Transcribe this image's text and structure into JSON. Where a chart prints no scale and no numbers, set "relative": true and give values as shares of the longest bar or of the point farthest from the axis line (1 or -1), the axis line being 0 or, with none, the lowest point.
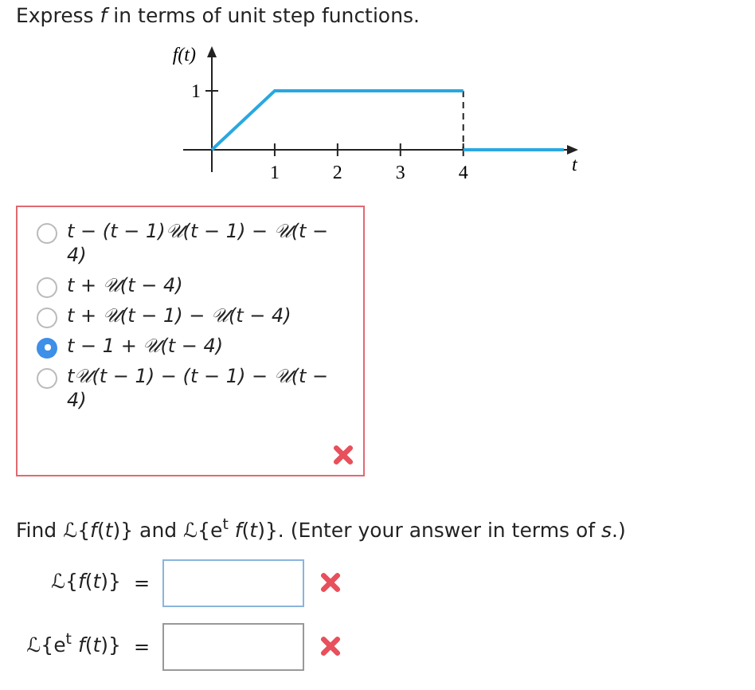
{
  "prompt": "Express *f* in terms of unit step functions.",
  "graph": {
    "chart_data": {
      "type": "line",
      "xlabel": "t",
      "ylabel": "f(t)",
      "relative": true,
      "x": [
        0,
        1,
        4,
        4,
        5.6
      ],
      "series": [
        {
          "color": "#29a8e0",
          "values": [
            0,
            1,
            1,
            0,
            0
          ]
        }
      ],
      "xticks": [
        1,
        2,
        3,
        4
      ],
      "xlim": [
        0,
        5.6
      ],
      "annotations": [
        "1"
      ]
    }
  },
  "choices": {
    "incorrect": true,
    "options": [
      {
        "label": "t − (t − 1)𝒰(t − 1) − 𝒰(t − 4)",
        "selected": false
      },
      {
        "label": "t + 𝒰(t − 4)",
        "selected": false
      },
      {
        "label": "t + 𝒰(t − 1) − 𝒰(t − 4)",
        "selected": false
      },
      {
        "label": "t − 1 + 𝒰(t − 4)",
        "selected": true
      },
      {
        "label": "t𝒰(t − 1) − (t − 1) − 𝒰(t − 4)",
        "selected": false
      }
    ]
  },
  "question": "Find ℒ{*f*(*t*)} and ℒ{e$^{t}$ *f*(*t*)}. (Enter your answer in terms of *s*.)",
  "answers": [
    {
      "label": "ℒ{*f*(*t*)}",
      "equals": "=",
      "incorrect": true
    },
    {
      "label": "ℒ{e$^{t}$ *f*(*t*)}",
      "equals": "=",
      "incorrect": true
    }
  ]
}
